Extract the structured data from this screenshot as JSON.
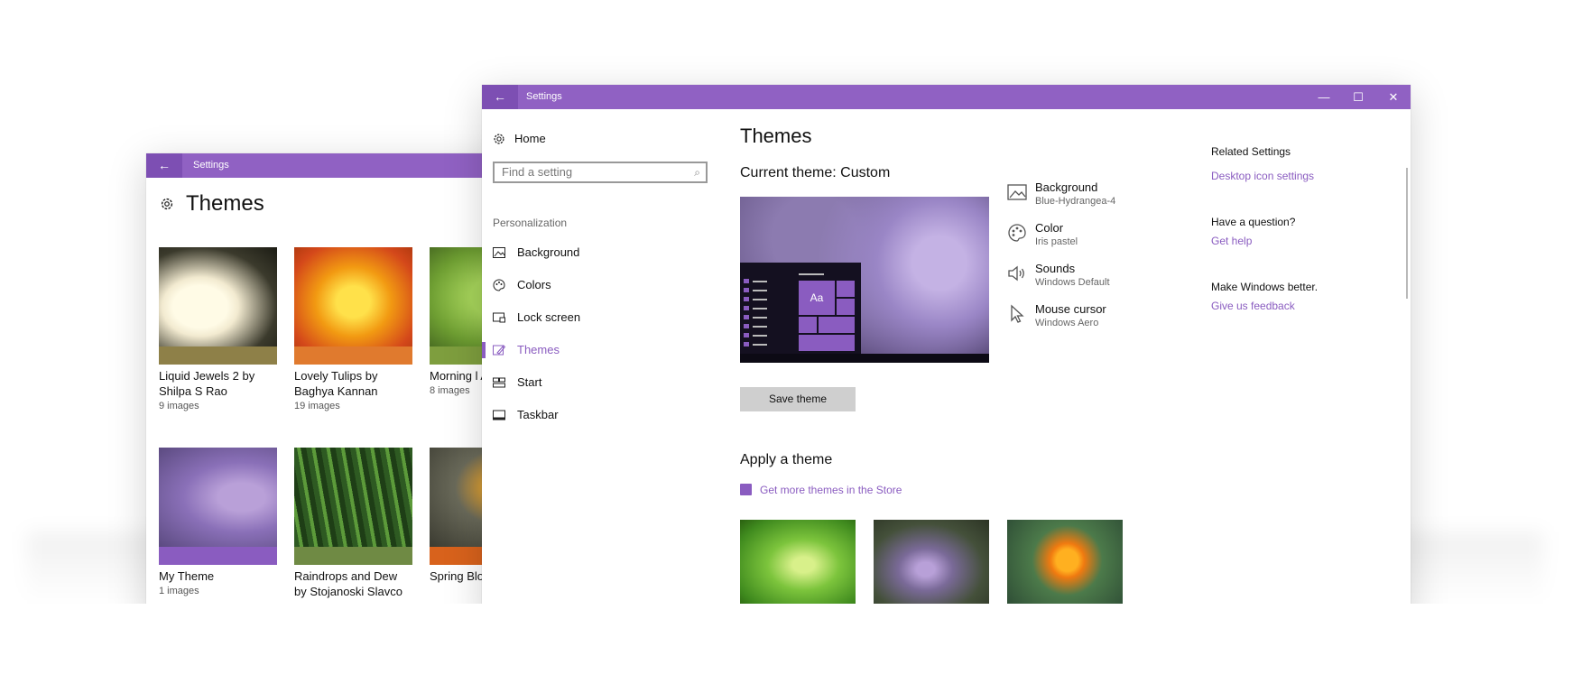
{
  "colors": {
    "accent": "#9061c3",
    "link": "#8a5cc0"
  },
  "small_window": {
    "title": "Settings",
    "back_icon": "back-arrow-icon",
    "heading": "Themes",
    "tiles": [
      {
        "name": "Liquid Jewels 2 by Shilpa S Rao",
        "count": "9 images",
        "strip": "#8e8048"
      },
      {
        "name": "Lovely Tulips by Baghya Kannan",
        "count": "19 images",
        "strip": "#e07a2e"
      },
      {
        "name": "Morning l Alexandr",
        "count": "8 images",
        "strip": "#7e9e3e"
      },
      {
        "name": "My Theme",
        "count": "1 images",
        "strip": "#8a5cc0"
      },
      {
        "name": "Raindrops and Dew by Stojanoski Slavco",
        "count": "",
        "strip": "#6f8a44"
      },
      {
        "name": "Spring Blo Rebecca H",
        "count": "",
        "strip": "#d8621c"
      }
    ]
  },
  "big_window": {
    "title": "Settings",
    "controls": {
      "minimize": "—",
      "maximize": "☐",
      "close": "✕"
    },
    "nav": {
      "home": "Home",
      "search_placeholder": "Find a setting",
      "section": "Personalization",
      "items": [
        {
          "label": "Background",
          "icon": "picture-icon"
        },
        {
          "label": "Colors",
          "icon": "palette-icon"
        },
        {
          "label": "Lock screen",
          "icon": "lock-screen-icon"
        },
        {
          "label": "Themes",
          "icon": "themes-icon",
          "active": true
        },
        {
          "label": "Start",
          "icon": "start-icon"
        },
        {
          "label": "Taskbar",
          "icon": "taskbar-icon"
        }
      ]
    },
    "main": {
      "title": "Themes",
      "current_theme": "Current theme: Custom",
      "preview_sample": "Aa",
      "properties": [
        {
          "name": "Background",
          "value": "Blue-Hydrangea-4",
          "icon": "picture-icon"
        },
        {
          "name": "Color",
          "value": "Iris pastel",
          "icon": "palette-icon"
        },
        {
          "name": "Sounds",
          "value": "Windows Default",
          "icon": "speaker-icon"
        },
        {
          "name": "Mouse cursor",
          "value": "Windows Aero",
          "icon": "cursor-icon"
        }
      ],
      "save_button": "Save theme",
      "apply_heading": "Apply a theme",
      "store_link": "Get more themes in the Store"
    },
    "related": {
      "heading": "Related Settings",
      "desktop_icon_link": "Desktop icon settings",
      "question_heading": "Have a question?",
      "help_link": "Get help",
      "better_heading": "Make Windows better.",
      "feedback_link": "Give us feedback"
    }
  }
}
